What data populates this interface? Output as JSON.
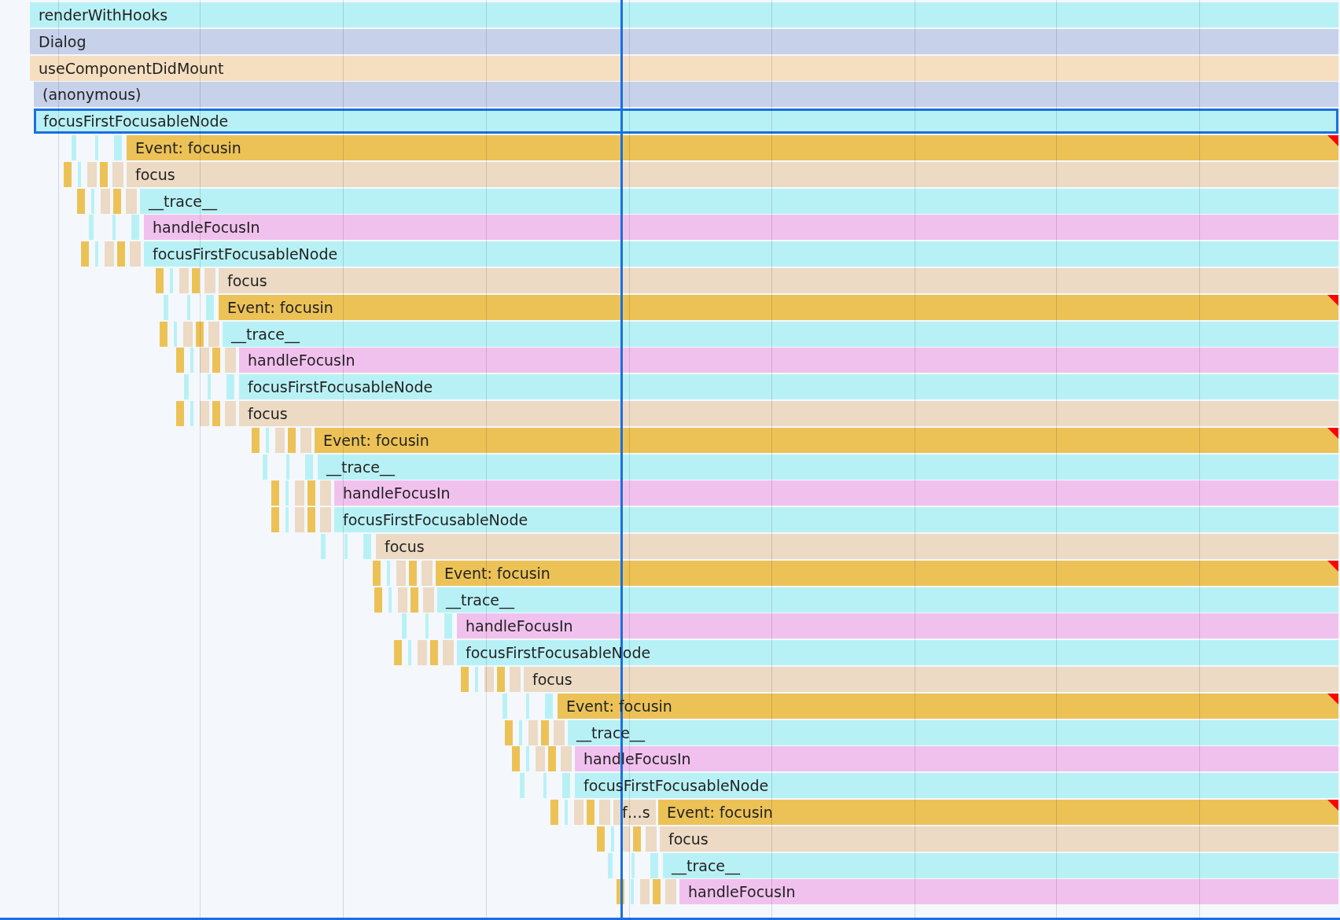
{
  "flame_chart": {
    "rows": [
      {
        "selected": false,
        "entries": [
          {
            "label": "renderWithHooks",
            "color": "#b8f1f5",
            "warning": false
          }
        ]
      },
      {
        "selected": false,
        "entries": [
          {
            "label": "Dialog",
            "color": "#c7d1ea",
            "warning": false
          }
        ]
      },
      {
        "selected": false,
        "entries": [
          {
            "label": "useComponentDidMount",
            "color": "#f5dfc0",
            "warning": false
          }
        ]
      },
      {
        "selected": false,
        "entries": [
          {
            "label": "(anonymous)",
            "color": "#c7d1ea",
            "warning": false
          }
        ]
      },
      {
        "selected": true,
        "entries": [
          {
            "label": "focusFirstFocusableNode",
            "color": "#b8f1f5",
            "warning": false
          }
        ]
      },
      {
        "selected": false,
        "entries": [
          {
            "label": "Event: focusin",
            "color": "#ecc257",
            "warning": true
          }
        ]
      },
      {
        "selected": false,
        "entries": [
          {
            "label": "focus",
            "color": "#ecdac4",
            "warning": false
          }
        ]
      },
      {
        "selected": false,
        "entries": [
          {
            "label": "__trace__",
            "color": "#b8f1f5",
            "warning": false
          }
        ]
      },
      {
        "selected": false,
        "entries": [
          {
            "label": "handleFocusIn",
            "color": "#f1c1ee",
            "warning": false
          }
        ]
      },
      {
        "selected": false,
        "entries": [
          {
            "label": "focusFirstFocusableNode",
            "color": "#b8f1f5",
            "warning": false
          }
        ]
      },
      {
        "selected": false,
        "entries": [
          {
            "label": "focus",
            "color": "#ecdac4",
            "warning": false
          }
        ]
      },
      {
        "selected": false,
        "entries": [
          {
            "label": "Event: focusin",
            "color": "#ecc257",
            "warning": true
          }
        ]
      },
      {
        "selected": false,
        "entries": [
          {
            "label": "__trace__",
            "color": "#b8f1f5",
            "warning": false
          }
        ]
      },
      {
        "selected": false,
        "entries": [
          {
            "label": "handleFocusIn",
            "color": "#f1c1ee",
            "warning": false
          }
        ]
      },
      {
        "selected": false,
        "entries": [
          {
            "label": "focusFirstFocusableNode",
            "color": "#b8f1f5",
            "warning": false
          }
        ]
      },
      {
        "selected": false,
        "entries": [
          {
            "label": "focus",
            "color": "#ecdac4",
            "warning": false
          }
        ]
      },
      {
        "selected": false,
        "entries": [
          {
            "label": "Event: focusin",
            "color": "#ecc257",
            "warning": true
          }
        ]
      },
      {
        "selected": false,
        "entries": [
          {
            "label": "__trace__",
            "color": "#b8f1f5",
            "warning": false
          }
        ]
      },
      {
        "selected": false,
        "entries": [
          {
            "label": "handleFocusIn",
            "color": "#f1c1ee",
            "warning": false
          }
        ]
      },
      {
        "selected": false,
        "entries": [
          {
            "label": "focusFirstFocusableNode",
            "color": "#b8f1f5",
            "warning": false
          }
        ]
      },
      {
        "selected": false,
        "entries": [
          {
            "label": "focus",
            "color": "#ecdac4",
            "warning": false
          }
        ]
      },
      {
        "selected": false,
        "entries": [
          {
            "label": "Event: focusin",
            "color": "#ecc257",
            "warning": true
          }
        ]
      },
      {
        "selected": false,
        "entries": [
          {
            "label": "__trace__",
            "color": "#b8f1f5",
            "warning": false
          }
        ]
      },
      {
        "selected": false,
        "entries": [
          {
            "label": "handleFocusIn",
            "color": "#f1c1ee",
            "warning": false
          }
        ]
      },
      {
        "selected": false,
        "entries": [
          {
            "label": "focusFirstFocusableNode",
            "color": "#b8f1f5",
            "warning": false
          }
        ]
      },
      {
        "selected": false,
        "entries": [
          {
            "label": "focus",
            "color": "#ecdac4",
            "warning": false
          }
        ]
      },
      {
        "selected": false,
        "entries": [
          {
            "label": "Event: focusin",
            "color": "#ecc257",
            "warning": true
          }
        ]
      },
      {
        "selected": false,
        "entries": [
          {
            "label": "__trace__",
            "color": "#b8f1f5",
            "warning": false
          }
        ]
      },
      {
        "selected": false,
        "entries": [
          {
            "label": "handleFocusIn",
            "color": "#f1c1ee",
            "warning": false
          }
        ]
      },
      {
        "selected": false,
        "entries": [
          {
            "label": "focusFirstFocusableNode",
            "color": "#b8f1f5",
            "warning": false
          }
        ]
      },
      {
        "selected": false,
        "entries": [
          {
            "label": "f…s",
            "color": "#ecdac4",
            "warning": false
          },
          {
            "label": "Event: focusin",
            "color": "#ecc257",
            "warning": true
          }
        ]
      },
      {
        "selected": false,
        "entries": [
          {
            "label": "focus",
            "color": "#ecdac4",
            "warning": false
          }
        ]
      },
      {
        "selected": false,
        "entries": [
          {
            "label": "__trace__",
            "color": "#b8f1f5",
            "warning": false
          }
        ]
      },
      {
        "selected": false,
        "entries": [
          {
            "label": "handleFocusIn",
            "color": "#f1c1ee",
            "warning": false
          }
        ]
      }
    ]
  }
}
